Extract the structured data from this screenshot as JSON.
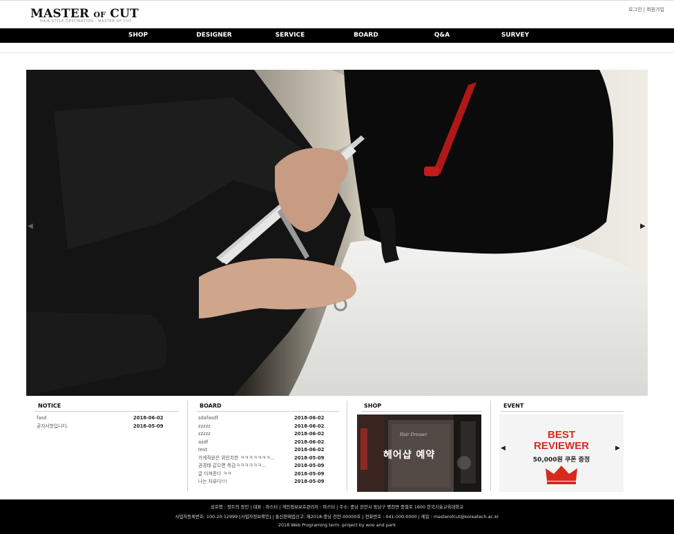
{
  "header": {
    "logo_main": "MASTER",
    "logo_of": "OF",
    "logo_end": "CUT",
    "logo_tagline": "HAIR STYLE DESTINATION - MASTER OF CUT",
    "login": "로그인",
    "separator": "|",
    "signup": "회원가입"
  },
  "nav": {
    "items": [
      {
        "label": "SHOP"
      },
      {
        "label": "DESIGNER"
      },
      {
        "label": "SERVICE"
      },
      {
        "label": "BOARD"
      },
      {
        "label": "Q&A"
      },
      {
        "label": "SURVEY"
      }
    ]
  },
  "slider": {
    "prev_glyph": "◀",
    "next_glyph": "▶"
  },
  "notice": {
    "title": "NOTICE",
    "rows": [
      {
        "title": "fasd",
        "date": "2018-06-02"
      },
      {
        "title": "공지사항입니다.",
        "date": "2018-05-09"
      }
    ]
  },
  "board": {
    "title": "BOARD",
    "rows": [
      {
        "title": "sdafasdf",
        "date": "2018-06-02"
      },
      {
        "title": "zzzzz",
        "date": "2018-06-02"
      },
      {
        "title": "zzzzz",
        "date": "2018-06-02"
      },
      {
        "title": "asdf",
        "date": "2018-06-02"
      },
      {
        "title": "test",
        "date": "2018-06-02"
      },
      {
        "title": "가게직원은 위인치한 ㅋㅋㅋㅋㅋㅋㅋ...",
        "date": "2018-05-09"
      },
      {
        "title": "권경태 같으면 목감ㅋㅋㅋㅋㅋㅋ...",
        "date": "2018-05-09"
      },
      {
        "title": "글 다쳐준다 ㅋㅋ",
        "date": "2018-05-09"
      },
      {
        "title": "나는 자유다!!!",
        "date": "2018-05-09"
      }
    ]
  },
  "shop": {
    "title": "SHOP",
    "banner_text": "헤어샵 예약",
    "sign_text": "Hair Dresser"
  },
  "event": {
    "title": "EVENT",
    "line1": "BEST",
    "line2": "REVIEWER",
    "line3": "50,000원 쿠폰 증정",
    "prev_glyph": "◀",
    "next_glyph": "▶"
  },
  "footer": {
    "line1": "상호명 : 컷트의 장인 | 대표 : 마스터 | 개인정보보호관리자 : 마스터 | 주소: 충남 천안시 동남구 병천면 충절로 1600 한국기술교육대학교",
    "line2": "사업자등록번호: 100-20-12999 [사업자정보확인] | 통신판매업신고: 제2018-충남 천안-00000호 | 전화번호 : 041-000-0000 | 메일 : masterofcut@koreatech.ac.kr",
    "line3": "2018 Web Programing term -project by woo and park"
  },
  "colors": {
    "nav_bg": "#000000",
    "accent_red": "#d62a1e",
    "footer_bg": "#000000"
  }
}
